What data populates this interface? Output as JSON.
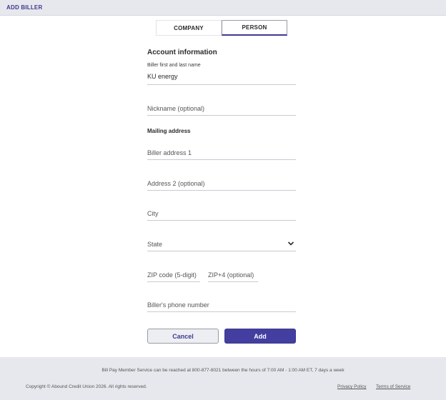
{
  "header": {
    "title": "ADD BILLER"
  },
  "tabs": [
    {
      "label": "COMPANY",
      "active": false
    },
    {
      "label": "PERSON",
      "active": true
    }
  ],
  "form": {
    "section_title": "Account information",
    "biller_name": {
      "label": "Biller first and last name",
      "value": "KU energy"
    },
    "nickname": {
      "placeholder": "Nickname (optional)"
    },
    "mailing_title": "Mailing address",
    "address1": {
      "placeholder": "Biller address 1"
    },
    "address2": {
      "placeholder": "Address 2 (optional)"
    },
    "city": {
      "placeholder": "City"
    },
    "state": {
      "placeholder": "State"
    },
    "zip": {
      "placeholder": "ZIP code (5-digit)"
    },
    "zip4": {
      "placeholder": "ZIP+4 (optional)"
    },
    "phone": {
      "placeholder": "Biller's phone number"
    }
  },
  "buttons": {
    "cancel": "Cancel",
    "add": "Add"
  },
  "footer": {
    "note": "Bill Pay Member Service can be reached at 800-877-8021 between the hours of 7:00 AM - 1:00 AM ET, 7 days a week",
    "copyright": "Copyright © Abound Credit Union 2026.  All rights reserved.",
    "privacy": "Privacy Policy",
    "terms": "Terms of Service"
  },
  "colors": {
    "accent": "#3e3a8f",
    "button_primary": "#433fa0",
    "header_bg": "#e7e8ed"
  },
  "icons": {
    "state_dropdown": "chevron-down-icon"
  }
}
